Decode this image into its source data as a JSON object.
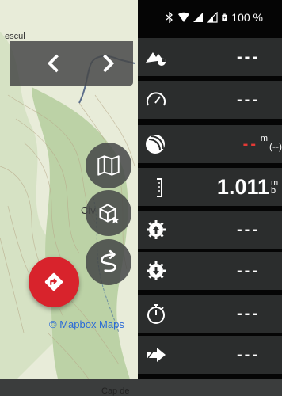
{
  "map": {
    "label_top": "escul",
    "label_mid": "Civ",
    "label_bottom": "Cap de",
    "attribution": "© Mapbox Maps"
  },
  "status_bar": {
    "battery": "100 %",
    "icons": [
      "bluetooth-icon",
      "wifi-icon",
      "signal-icon",
      "signal-icon",
      "battery-icon"
    ]
  },
  "nav": {
    "back_icon": "chevron-left-icon",
    "forward_icon": "chevron-right-icon"
  },
  "fabs": [
    "map-layers-icon",
    "favorite-place-icon",
    "route-icon",
    "navigate-icon"
  ],
  "rows": [
    {
      "icon": "altitude-icon",
      "value": "---"
    },
    {
      "icon": "speedometer-icon",
      "value": "---"
    },
    {
      "icon": "gps-accuracy-icon",
      "value": "--",
      "unit": "m",
      "unit_extra": "(--)"
    },
    {
      "icon": "barometer-icon",
      "value": "1.011",
      "unit": "mb"
    },
    {
      "icon": "ascent-icon",
      "value": "---"
    },
    {
      "icon": "descent-icon",
      "value": "---"
    },
    {
      "icon": "stopwatch-icon",
      "value": "---"
    },
    {
      "icon": "direction-arrow-icon",
      "value": "---"
    }
  ],
  "colors": {
    "accent_red": "#d8232c",
    "panel_bg": "#050505",
    "row_bg": "#2b2d2d"
  }
}
